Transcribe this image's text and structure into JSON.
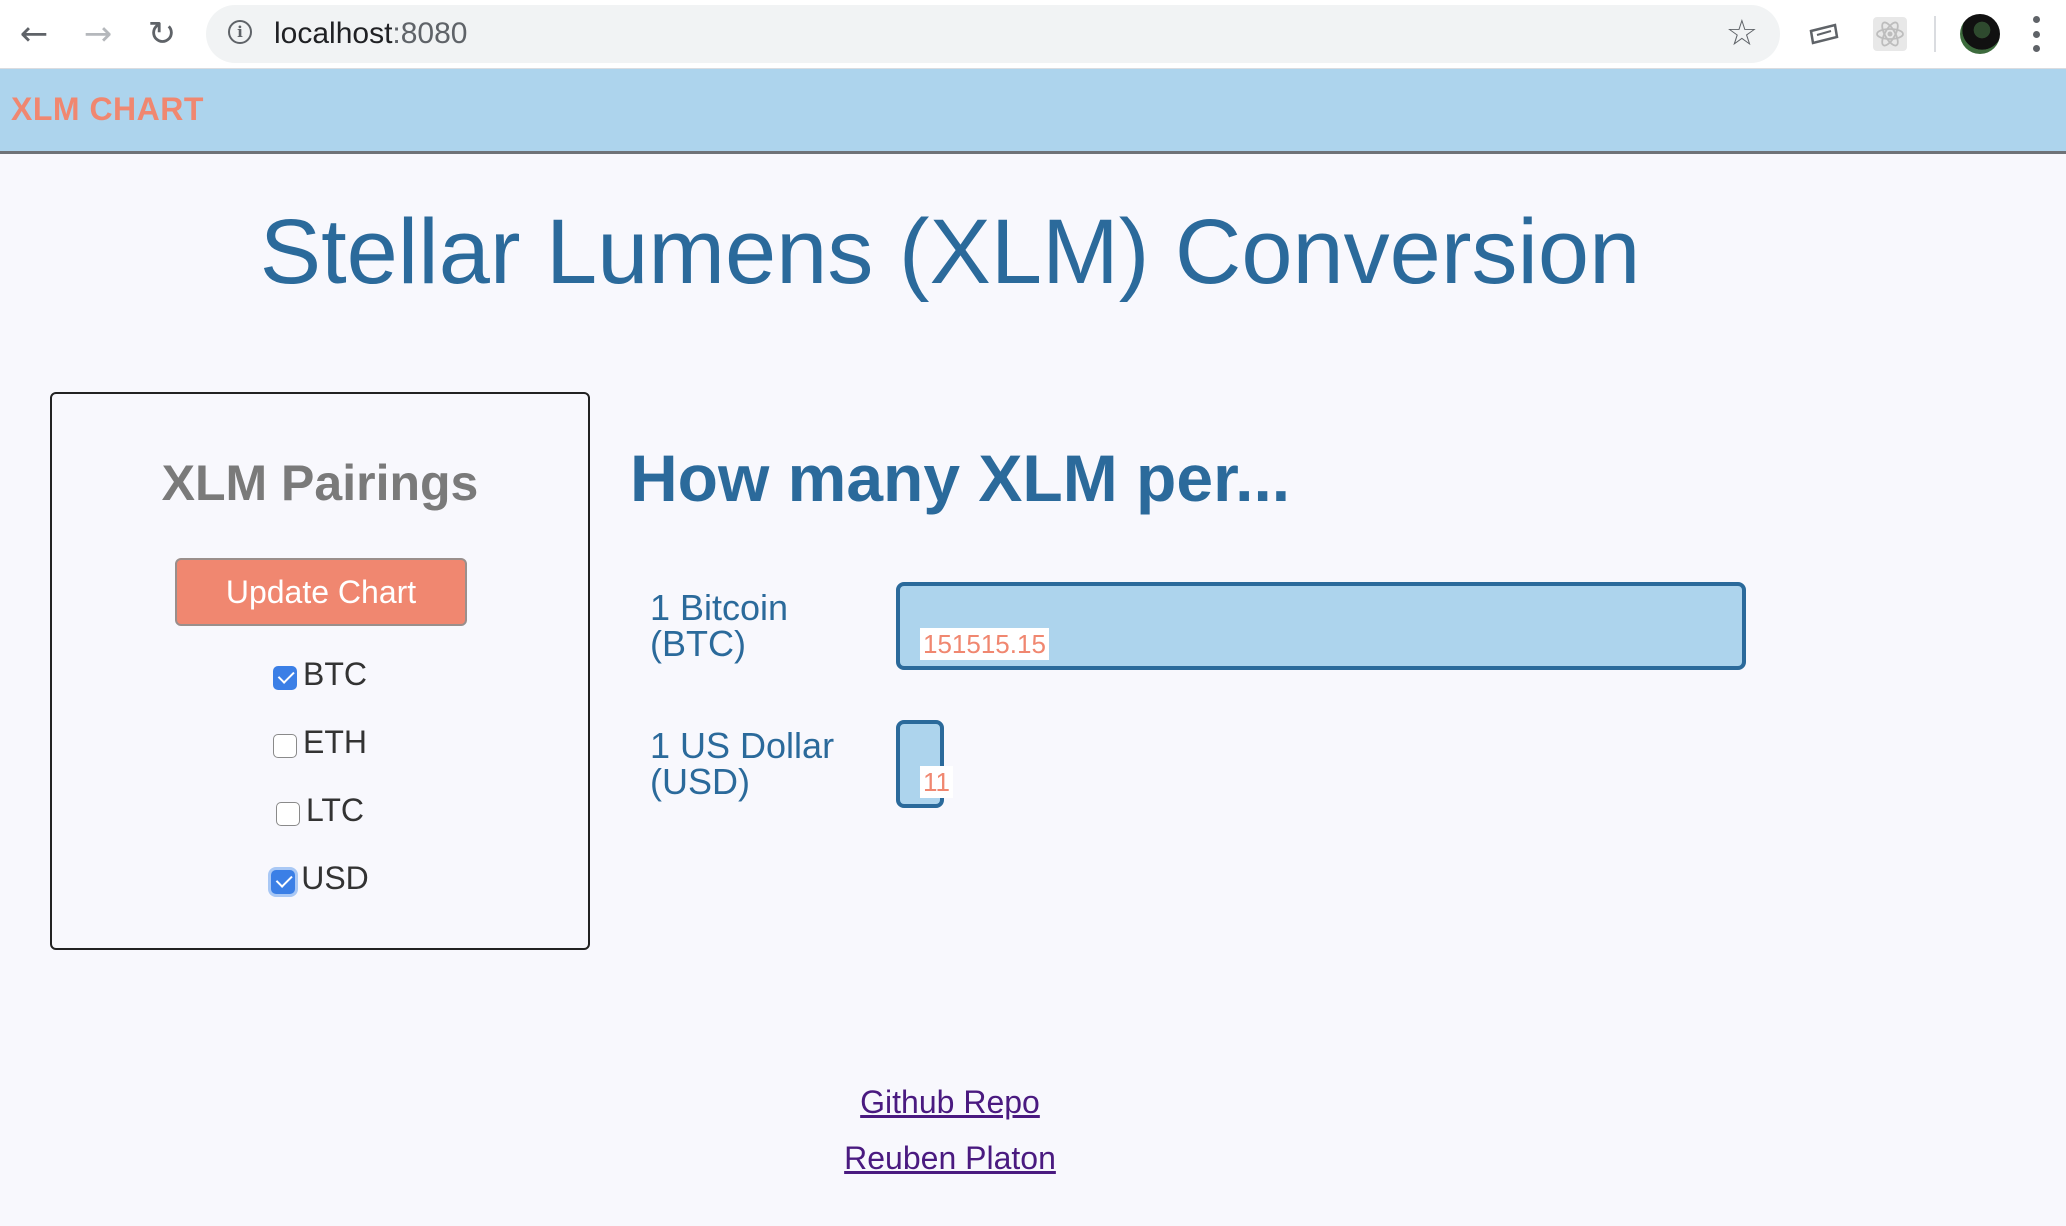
{
  "browser": {
    "url_host": "localhost",
    "url_port": ":8080",
    "nav_icons": {
      "back": "back-arrow-icon",
      "forward": "forward-arrow-icon",
      "reload": "reload-icon"
    },
    "extensions": [
      "extension-icon",
      "react-devtools-icon"
    ]
  },
  "navbar": {
    "brand": "XLM CHART",
    "brand_color": "#f08770",
    "background": "#add4ed"
  },
  "page": {
    "title": "Stellar Lumens (XLM) Conversion"
  },
  "pairings": {
    "title": "XLM Pairings",
    "update_button": "Update Chart",
    "options": [
      {
        "label": "BTC",
        "checked": true
      },
      {
        "label": "ETH",
        "checked": false
      },
      {
        "label": "LTC",
        "checked": false
      },
      {
        "label": "USD",
        "checked": true
      }
    ]
  },
  "conversion": {
    "heading": "How many XLM per...",
    "rows": [
      {
        "label_line1": "1 Bitcoin",
        "label_line2": "(BTC)",
        "value": "151515.15"
      },
      {
        "label_line1": "1 US Dollar",
        "label_line2": "(USD)",
        "value": "11"
      }
    ]
  },
  "chart_data": {
    "type": "bar",
    "categories": [
      "1 Bitcoin (BTC)",
      "1 US Dollar (USD)"
    ],
    "values": [
      151515.15,
      11
    ],
    "title": "How many XLM per..."
  },
  "footer": {
    "links": [
      "Github Repo",
      "Reuben Platon"
    ]
  }
}
